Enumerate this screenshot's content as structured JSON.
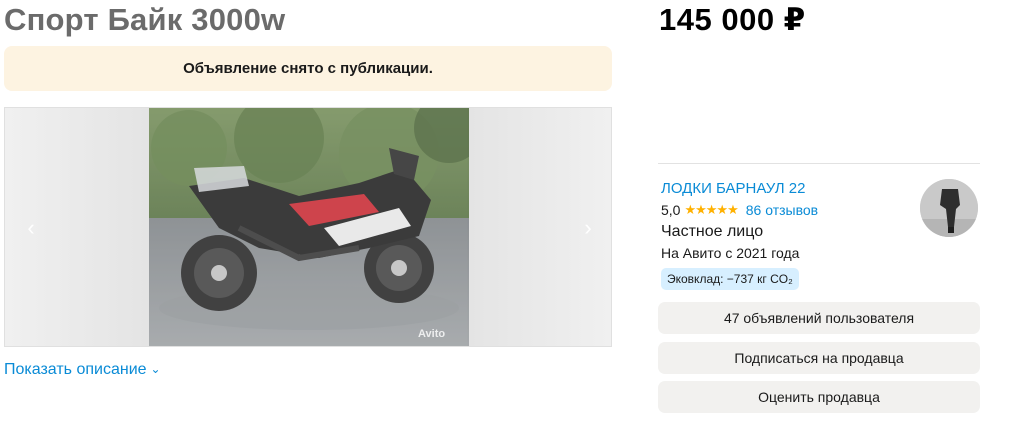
{
  "listing": {
    "title": "Спорт Байк 3000w",
    "price": "145 000 ₽",
    "notice": "Объявление снято с публикации.",
    "show_description": "Показать описание",
    "watermark": "Avito"
  },
  "seller": {
    "name": "ЛОДКИ БАРНАУЛ 22",
    "rating": "5,0",
    "stars": "★★★★★",
    "reviews": "86 отзывов",
    "type": "Частное лицо",
    "since": "На Авито с 2021 года",
    "eco": "Эковклад: −737 кг CO₂"
  },
  "buttons": {
    "listings": "47 объявлений пользователя",
    "subscribe": "Подписаться на продавца",
    "rate": "Оценить продавца"
  },
  "icons": {
    "gallery_prev": "chevron-left-icon",
    "gallery_next": "chevron-right-icon",
    "show_more": "chevron-down-icon"
  },
  "colors": {
    "link": "#0a8bd6",
    "notice_bg": "#fdf3e1",
    "eco_bg": "#d7efff",
    "star": "#ffb100",
    "button_bg": "#f2f1ef"
  }
}
